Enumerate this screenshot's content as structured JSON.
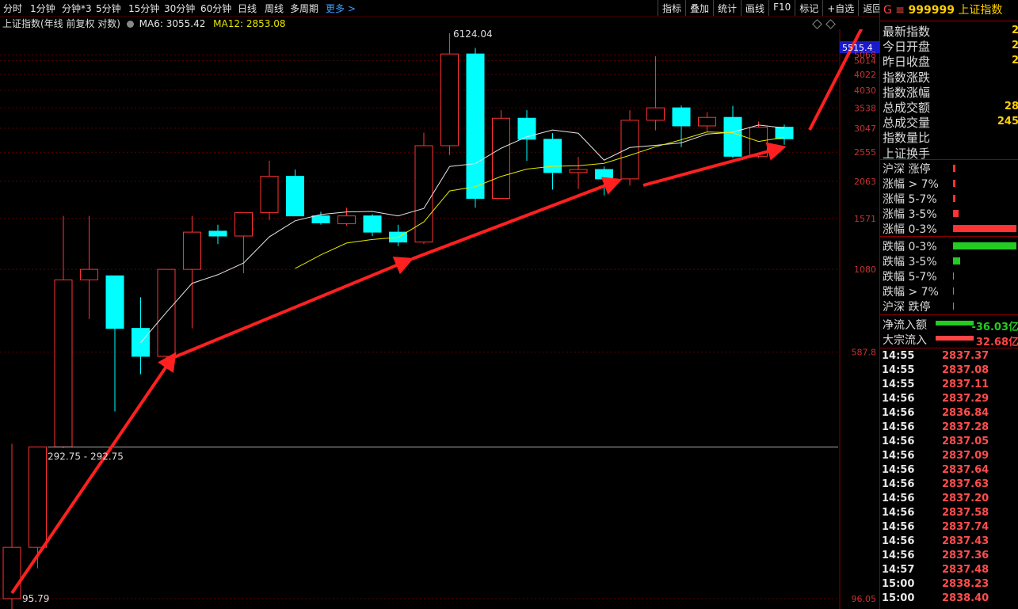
{
  "toolbar": {
    "periods": [
      "分时",
      "1分钟",
      "分钟*3",
      "5分钟",
      "15分钟",
      "30分钟",
      "60分钟",
      "日线",
      "周线",
      "多周期"
    ],
    "more": "更多 >",
    "buttons": [
      "指标",
      "叠加",
      "统计",
      "画线",
      "F10",
      "标记",
      "+自选",
      "返回"
    ]
  },
  "info": {
    "title": "上证指数(年线 前复权 对数)",
    "ma6": "MA6: 3055.42",
    "ma12": "MA12: 2853.08"
  },
  "chart_data": {
    "type": "candlestick",
    "y_axis_labels": [
      "5515.4",
      "5068",
      "5014",
      "4022",
      "4030",
      "3538",
      "3047",
      "2555",
      "2063",
      "1571",
      "1080",
      "587.8",
      "96.05"
    ],
    "current_price_tag": "5515.4",
    "high_label": "6124.04",
    "low_label": "95.79",
    "crosshair_label": "292.75 - 292.75",
    "up_color": "#ff3232",
    "down_color": "#00ffff",
    "candles": [
      {
        "o": 96,
        "h": 300,
        "l": 80,
        "c": 140,
        "up": true
      },
      {
        "o": 140,
        "h": 293,
        "l": 120,
        "c": 293,
        "up": true
      },
      {
        "o": 293,
        "h": 1600,
        "l": 290,
        "c": 1000,
        "up": true
      },
      {
        "o": 1000,
        "h": 1600,
        "l": 750,
        "c": 1080,
        "up": true
      },
      {
        "o": 1030,
        "h": 1000,
        "l": 380,
        "c": 700,
        "up": false
      },
      {
        "o": 700,
        "h": 880,
        "l": 500,
        "c": 570,
        "up": false
      },
      {
        "o": 570,
        "h": 980,
        "l": 520,
        "c": 1080,
        "up": true
      },
      {
        "o": 1080,
        "h": 1600,
        "l": 700,
        "c": 1420,
        "up": true
      },
      {
        "o": 1430,
        "h": 1500,
        "l": 1300,
        "c": 1380,
        "up": false
      },
      {
        "o": 1380,
        "h": 1600,
        "l": 1050,
        "c": 1640,
        "up": true
      },
      {
        "o": 1640,
        "h": 2400,
        "l": 1550,
        "c": 2140,
        "up": true
      },
      {
        "o": 2140,
        "h": 2250,
        "l": 1650,
        "c": 1600,
        "up": false
      },
      {
        "o": 1600,
        "h": 1650,
        "l": 1500,
        "c": 1520,
        "up": false
      },
      {
        "o": 1510,
        "h": 1700,
        "l": 1490,
        "c": 1600,
        "up": true
      },
      {
        "o": 1600,
        "h": 1620,
        "l": 1380,
        "c": 1420,
        "up": false
      },
      {
        "o": 1420,
        "h": 1500,
        "l": 1280,
        "c": 1320,
        "up": false
      },
      {
        "o": 1320,
        "h": 2950,
        "l": 1300,
        "c": 2680,
        "up": true
      },
      {
        "o": 2680,
        "h": 6124,
        "l": 2500,
        "c": 5260,
        "up": true
      },
      {
        "o": 5260,
        "h": 5500,
        "l": 1700,
        "c": 1820,
        "up": false
      },
      {
        "o": 1820,
        "h": 3480,
        "l": 1840,
        "c": 3280,
        "up": true
      },
      {
        "o": 3280,
        "h": 3480,
        "l": 2400,
        "c": 2810,
        "up": false
      },
      {
        "o": 2810,
        "h": 2940,
        "l": 1940,
        "c": 2200,
        "up": false
      },
      {
        "o": 2200,
        "h": 2470,
        "l": 1950,
        "c": 2250,
        "up": true
      },
      {
        "o": 2250,
        "h": 2300,
        "l": 1860,
        "c": 2100,
        "up": false
      },
      {
        "o": 2100,
        "h": 3480,
        "l": 2000,
        "c": 3230,
        "up": true
      },
      {
        "o": 3230,
        "h": 5170,
        "l": 3000,
        "c": 3540,
        "up": true
      },
      {
        "o": 3540,
        "h": 3600,
        "l": 2650,
        "c": 3100,
        "up": false
      },
      {
        "o": 3100,
        "h": 3430,
        "l": 2980,
        "c": 3300,
        "up": true
      },
      {
        "o": 3300,
        "h": 3590,
        "l": 2450,
        "c": 2480,
        "up": false
      },
      {
        "o": 2480,
        "h": 3200,
        "l": 2450,
        "c": 3070,
        "up": true
      },
      {
        "o": 3070,
        "h": 3130,
        "l": 2700,
        "c": 2820,
        "up": false
      }
    ]
  },
  "right_panel": {
    "code_prefix": "G ≡",
    "code": "999999",
    "name": "上证指数",
    "stats": [
      {
        "label": "最新指数",
        "value": "2"
      },
      {
        "label": "今日开盘",
        "value": "2"
      },
      {
        "label": "昨日收盘",
        "value": "2"
      },
      {
        "label": "指数涨跌",
        "value": ""
      },
      {
        "label": "指数涨幅",
        "value": ""
      },
      {
        "label": "总成交额",
        "value": "28"
      },
      {
        "label": "总成交量",
        "value": "245"
      },
      {
        "label": "指数量比",
        "value": ""
      },
      {
        "label": "上证换手",
        "value": ""
      }
    ],
    "dist_up": [
      {
        "label": "沪深 涨停",
        "level": 0.02
      },
      {
        "label": "涨幅 > 7%",
        "level": 0.02
      },
      {
        "label": "涨幅 5-7%",
        "level": 0.02
      },
      {
        "label": "涨幅 3-5%",
        "level": 0.05
      },
      {
        "label": "涨幅 0-3%",
        "level": 0.55
      }
    ],
    "dist_down": [
      {
        "label": "跌幅 0-3%",
        "level": 0.8
      },
      {
        "label": "跌幅 3-5%",
        "level": 0.09
      },
      {
        "label": "跌幅 5-7%",
        "level": 0.01
      },
      {
        "label": "跌幅 > 7%",
        "level": 0.01
      },
      {
        "label": "沪深 跌停",
        "level": 0.01
      }
    ],
    "flow": [
      {
        "label": "净流入额",
        "value": "-36.03亿",
        "color": "#22cc22"
      },
      {
        "label": "大宗流入",
        "value": "32.68亿",
        "color": "#ff4444"
      }
    ],
    "ticks": [
      {
        "t": "14:55",
        "p": "2837.37"
      },
      {
        "t": "14:55",
        "p": "2837.08"
      },
      {
        "t": "14:55",
        "p": "2837.11"
      },
      {
        "t": "14:56",
        "p": "2837.29"
      },
      {
        "t": "14:56",
        "p": "2836.84"
      },
      {
        "t": "14:56",
        "p": "2837.28"
      },
      {
        "t": "14:56",
        "p": "2837.05"
      },
      {
        "t": "14:56",
        "p": "2837.09"
      },
      {
        "t": "14:56",
        "p": "2837.64"
      },
      {
        "t": "14:56",
        "p": "2837.63"
      },
      {
        "t": "14:56",
        "p": "2837.20"
      },
      {
        "t": "14:56",
        "p": "2837.58"
      },
      {
        "t": "14:56",
        "p": "2837.74"
      },
      {
        "t": "14:56",
        "p": "2837.43"
      },
      {
        "t": "14:56",
        "p": "2837.36"
      },
      {
        "t": "14:57",
        "p": "2837.48"
      },
      {
        "t": "15:00",
        "p": "2838.23"
      },
      {
        "t": "15:00",
        "p": "2838.40"
      }
    ]
  }
}
